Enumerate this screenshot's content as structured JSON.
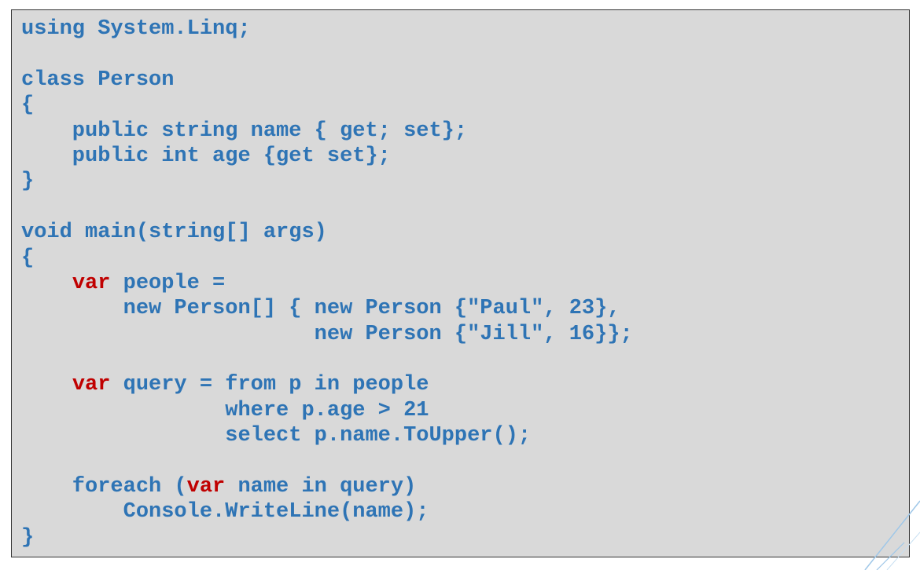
{
  "code": {
    "lines": [
      [
        {
          "t": "using System.Linq;"
        }
      ],
      [],
      [
        {
          "t": "class Person"
        }
      ],
      [
        {
          "t": "{"
        }
      ],
      [
        {
          "t": "    public string name { get; set};"
        }
      ],
      [
        {
          "t": "    public int age {get set};"
        }
      ],
      [
        {
          "t": "}"
        }
      ],
      [],
      [
        {
          "t": "void main(string[] args)"
        }
      ],
      [
        {
          "t": "{"
        }
      ],
      [
        {
          "t": "    "
        },
        {
          "t": "var",
          "kw": true
        },
        {
          "t": " people ="
        }
      ],
      [
        {
          "t": "        new Person[] { new Person {\"Paul\", 23},"
        }
      ],
      [
        {
          "t": "                       new Person {\"Jill\", 16}};"
        }
      ],
      [],
      [
        {
          "t": "    "
        },
        {
          "t": "var",
          "kw": true
        },
        {
          "t": " query = from p in people"
        }
      ],
      [
        {
          "t": "                where p.age > 21"
        }
      ],
      [
        {
          "t": "                select p.name.ToUpper();"
        }
      ],
      [],
      [
        {
          "t": "    foreach ("
        },
        {
          "t": "var",
          "kw": true
        },
        {
          "t": " name in query)"
        }
      ],
      [
        {
          "t": "        Console.WriteLine(name);"
        }
      ],
      [
        {
          "t": "}"
        }
      ]
    ]
  },
  "colors": {
    "code_text": "#2e74b5",
    "keyword": "#c00000",
    "code_background": "#d9d9d9",
    "border": "#333333",
    "accent_line": "#9fc7e8"
  }
}
